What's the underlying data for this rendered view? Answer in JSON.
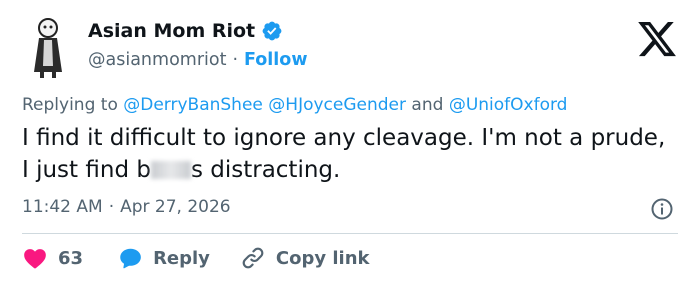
{
  "author": {
    "name": "Asian Mom Riot",
    "handle": "@asianmomriot",
    "separator": "·",
    "follow_label": "Follow"
  },
  "replying": {
    "prefix": "Replying to",
    "mentions": [
      "@DerryBanShee",
      "@HJoyceGender",
      "@UniofOxford"
    ],
    "conjunction": "and"
  },
  "tweet": {
    "text_before": "I find it difficult to ignore any cleavage. I'm not a prude, I just find b",
    "text_after": "s distracting."
  },
  "meta": {
    "time": "11:42 AM",
    "separator": "·",
    "date": "Apr 27, 2026"
  },
  "actions": {
    "likes": "63",
    "reply_label": "Reply",
    "copy_label": "Copy link"
  },
  "colors": {
    "accent": "#1d9bf0",
    "like": "#f91880",
    "muted": "#536471"
  }
}
